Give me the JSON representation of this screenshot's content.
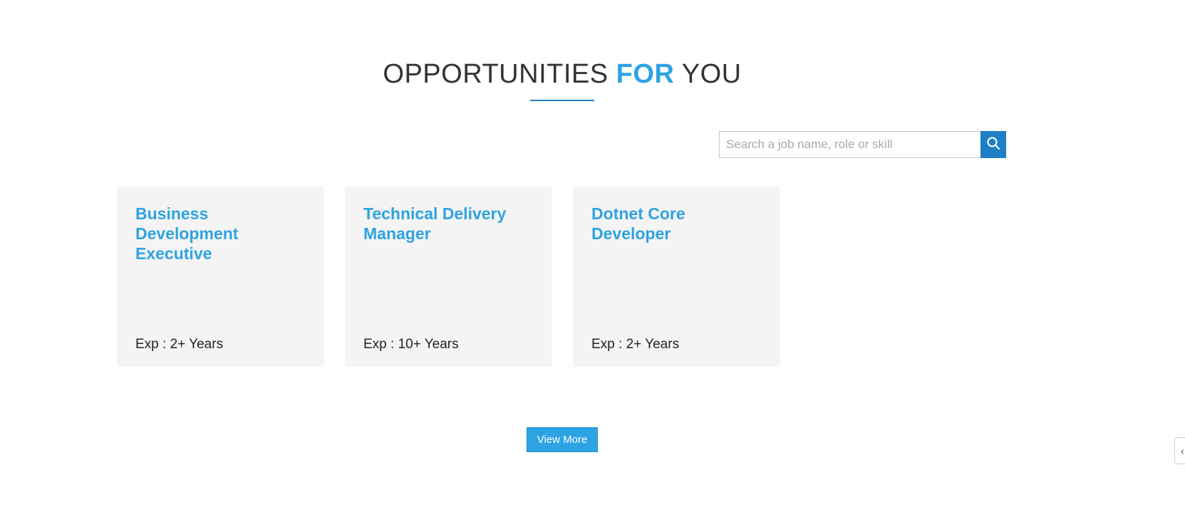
{
  "section": {
    "heading_part1": "OPPORTUNITIES ",
    "heading_accent": "FOR",
    "heading_part2": " YOU",
    "accent_color": "#2ea3e3"
  },
  "search": {
    "placeholder": "Search a job name, role or skill",
    "value": "",
    "button_icon": "search-icon",
    "button_color": "#1f7fc6"
  },
  "jobs": [
    {
      "title": "Business Development Executive",
      "exp": "Exp : 2+ Years"
    },
    {
      "title": "Technical Delivery Manager",
      "exp": "Exp : 10+ Years"
    },
    {
      "title": "Dotnet Core Developer",
      "exp": "Exp : 2+ Years"
    }
  ],
  "view_more_label": "View More",
  "side_tab": {
    "icon": "chevron-left-icon",
    "glyph": "‹"
  }
}
